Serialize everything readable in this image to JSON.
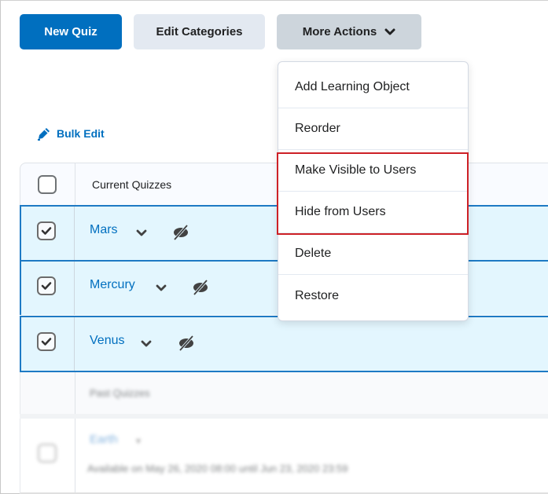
{
  "toolbar": {
    "new_quiz_label": "New Quiz",
    "edit_categories_label": "Edit Categories",
    "more_actions_label": "More Actions"
  },
  "bulk_edit": {
    "label": "Bulk Edit",
    "icon": "pencil-icon"
  },
  "table": {
    "header": {
      "label": "Current Quizzes",
      "select_all_checked": false
    },
    "selected_rows": [
      {
        "name": "Mars",
        "checked": true,
        "visibility_icon": "eye-slash-icon"
      },
      {
        "name": "Mercury",
        "checked": true,
        "visibility_icon": "eye-slash-icon"
      },
      {
        "name": "Venus",
        "checked": true,
        "visibility_icon": "eye-slash-icon"
      }
    ],
    "group": {
      "label": "Past Quizzes"
    },
    "item": {
      "name": "Earth",
      "checked": false,
      "availability": "Available on May 26, 2020 08:00 until Jun 23, 2020 23:59"
    }
  },
  "more_actions_menu": {
    "items": [
      {
        "label": "Add Learning Object"
      },
      {
        "label": "Reorder"
      },
      {
        "label": "Make Visible to Users",
        "highlighted": true
      },
      {
        "label": "Hide from Users",
        "highlighted": true
      },
      {
        "label": "Delete"
      },
      {
        "label": "Restore"
      }
    ]
  },
  "colors": {
    "primary": "#006fbf",
    "selected_row_bg": "#e3f6fe",
    "selected_row_border": "#1e7ac4",
    "highlight_border": "#cd2026"
  }
}
